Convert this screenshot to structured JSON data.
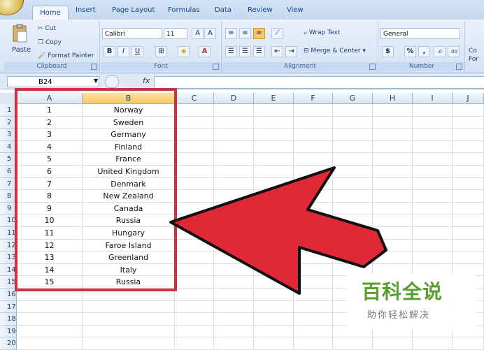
{
  "ribbon": {
    "tabs": [
      "Home",
      "Insert",
      "Page Layout",
      "Formulas",
      "Data",
      "Review",
      "View"
    ],
    "clipboard": {
      "label": "Clipboard",
      "paste": "Paste",
      "cut": "Cut",
      "copy": "Copy",
      "format_painter": "Format Painter"
    },
    "font": {
      "label": "Font",
      "name": "Calibri",
      "size": "11"
    },
    "alignment": {
      "label": "Alignment",
      "wrap_text": "Wrap Text",
      "merge_center": "Merge & Center"
    },
    "number": {
      "label": "Number",
      "format": "General",
      "currency": "$",
      "percent": "%",
      "comma": ","
    },
    "styles_partial": [
      "Co",
      "For"
    ]
  },
  "formula_bar": {
    "name_box": "B24",
    "fx": "fx"
  },
  "sheet": {
    "columns": [
      "A",
      "B",
      "C",
      "D",
      "E",
      "F",
      "G",
      "H",
      "I",
      "J"
    ],
    "rows": [
      "1",
      "2",
      "3",
      "4",
      "5",
      "6",
      "7",
      "8",
      "9",
      "10",
      "11",
      "12",
      "13",
      "14",
      "15",
      "16",
      "17",
      "18",
      "19",
      "20"
    ],
    "data": [
      [
        "1",
        "Norway"
      ],
      [
        "2",
        "Sweden"
      ],
      [
        "3",
        "Germany"
      ],
      [
        "4",
        "Finland"
      ],
      [
        "5",
        "France"
      ],
      [
        "6",
        "United Kingdom"
      ],
      [
        "7",
        "Denmark"
      ],
      [
        "8",
        "New Zealand"
      ],
      [
        "9",
        "Canada"
      ],
      [
        "10",
        "Russia"
      ],
      [
        "11",
        "Hungary"
      ],
      [
        "12",
        "Faroe Island"
      ],
      [
        "13",
        "Greenland"
      ],
      [
        "14",
        "Italy"
      ],
      [
        "15",
        "Russia"
      ]
    ]
  },
  "watermark": {
    "title": "百科全说",
    "subtitle": "助你轻松解决"
  },
  "colors": {
    "highlight": "#d1303e",
    "arrow": "#e02836",
    "selected_col": "#f5c96a"
  }
}
